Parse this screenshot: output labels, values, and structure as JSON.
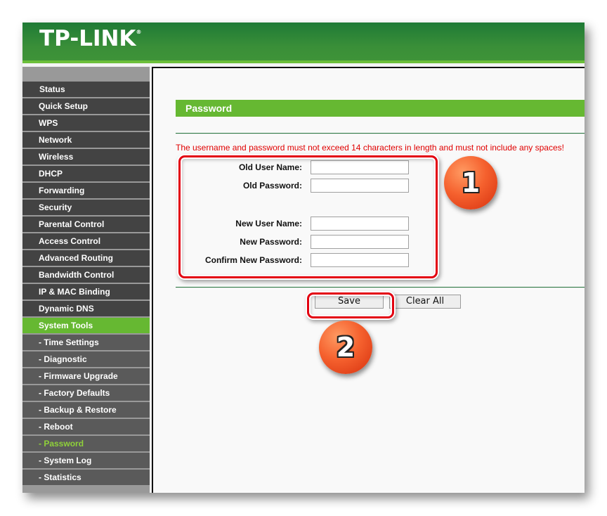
{
  "header": {
    "logo": "TP-LINK",
    "logo_mark": "®"
  },
  "sidebar": {
    "items": [
      {
        "label": "Status",
        "type": "main",
        "state": "normal"
      },
      {
        "label": "Quick Setup",
        "type": "main",
        "state": "normal"
      },
      {
        "label": "WPS",
        "type": "main",
        "state": "normal"
      },
      {
        "label": "Network",
        "type": "main",
        "state": "normal"
      },
      {
        "label": "Wireless",
        "type": "main",
        "state": "normal"
      },
      {
        "label": "DHCP",
        "type": "main",
        "state": "normal"
      },
      {
        "label": "Forwarding",
        "type": "main",
        "state": "normal"
      },
      {
        "label": "Security",
        "type": "main",
        "state": "normal"
      },
      {
        "label": "Parental Control",
        "type": "main",
        "state": "normal"
      },
      {
        "label": "Access Control",
        "type": "main",
        "state": "normal"
      },
      {
        "label": "Advanced Routing",
        "type": "main",
        "state": "normal"
      },
      {
        "label": "Bandwidth Control",
        "type": "main",
        "state": "normal"
      },
      {
        "label": "IP & MAC Binding",
        "type": "main",
        "state": "normal"
      },
      {
        "label": "Dynamic DNS",
        "type": "main",
        "state": "normal"
      },
      {
        "label": "System Tools",
        "type": "main",
        "state": "active"
      },
      {
        "label": "- Time Settings",
        "type": "sub",
        "state": "normal"
      },
      {
        "label": "- Diagnostic",
        "type": "sub",
        "state": "normal"
      },
      {
        "label": "- Firmware Upgrade",
        "type": "sub",
        "state": "normal"
      },
      {
        "label": "- Factory Defaults",
        "type": "sub",
        "state": "normal"
      },
      {
        "label": "- Backup & Restore",
        "type": "sub",
        "state": "normal"
      },
      {
        "label": "- Reboot",
        "type": "sub",
        "state": "normal"
      },
      {
        "label": "- Password",
        "type": "sub",
        "state": "current"
      },
      {
        "label": "- System Log",
        "type": "sub",
        "state": "normal"
      },
      {
        "label": "- Statistics",
        "type": "sub",
        "state": "normal"
      }
    ]
  },
  "main": {
    "title": "Password",
    "warning": "The username and password must not exceed 14 characters in length and must not include any spaces!",
    "fields": {
      "old_user_name": {
        "label": "Old User Name:",
        "value": ""
      },
      "old_password": {
        "label": "Old Password:",
        "value": ""
      },
      "new_user_name": {
        "label": "New User Name:",
        "value": ""
      },
      "new_password": {
        "label": "New Password:",
        "value": ""
      },
      "confirm_new_password": {
        "label": "Confirm New Password:",
        "value": ""
      }
    },
    "buttons": {
      "save": "Save",
      "clear_all": "Clear All"
    }
  },
  "annotations": {
    "step1": "1",
    "step2": "2",
    "highlight_color": "#e30010",
    "badge_color": "#f5612e"
  },
  "colors": {
    "brand_green": "#3a8f38",
    "accent_green": "#66b832",
    "menu_dark": "#434343",
    "menu_sub": "#5a5a5a",
    "warning_red": "#e00000"
  }
}
